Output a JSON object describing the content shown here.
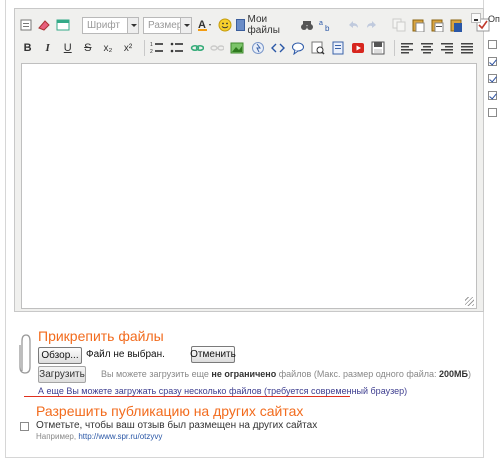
{
  "toolbar": {
    "font_combo": "Шрифт",
    "size_combo": "Размер",
    "my_files_label": "Мои файлы",
    "row1_icons": [
      "source-icon",
      "eraser-icon",
      "template-icon"
    ],
    "row2_labels": {
      "bold": "B",
      "italic": "I",
      "underline": "U",
      "strike": "S",
      "subscript": "x₂",
      "superscript": "x²"
    }
  },
  "attach": {
    "title": "Прикрепить файлы",
    "browse_label": "Обзор...",
    "file_status": "Файл не выбран.",
    "cancel_label": "Отменить",
    "upload_label": "Загрузить",
    "upload_info_pre": "Вы можете загрузить еще ",
    "upload_info_bold": "не ограничено",
    "upload_info_post": " файлов (Макс. размер одного файла: ",
    "upload_info_max": "200МБ",
    "upload_info_end": ")",
    "multi_note": "А еще Вы можете загружать сразу несколько файлов (требуется современный браузер)"
  },
  "publish": {
    "title": "Разрешить публикацию на других сайтах",
    "checkbox_label": "Отметьте, чтобы ваш отзыв был размещен на других сайтах",
    "example_prefix": "Например,",
    "example_url": "http://www.spr.ru/otzyvy"
  },
  "right_panel": {
    "heading": "Оп",
    "checkboxes": [
      false,
      true,
      true,
      true,
      false
    ]
  },
  "colors": {
    "accent": "#f26b1d",
    "link": "#2a57a6",
    "underline": "#e0301e"
  }
}
